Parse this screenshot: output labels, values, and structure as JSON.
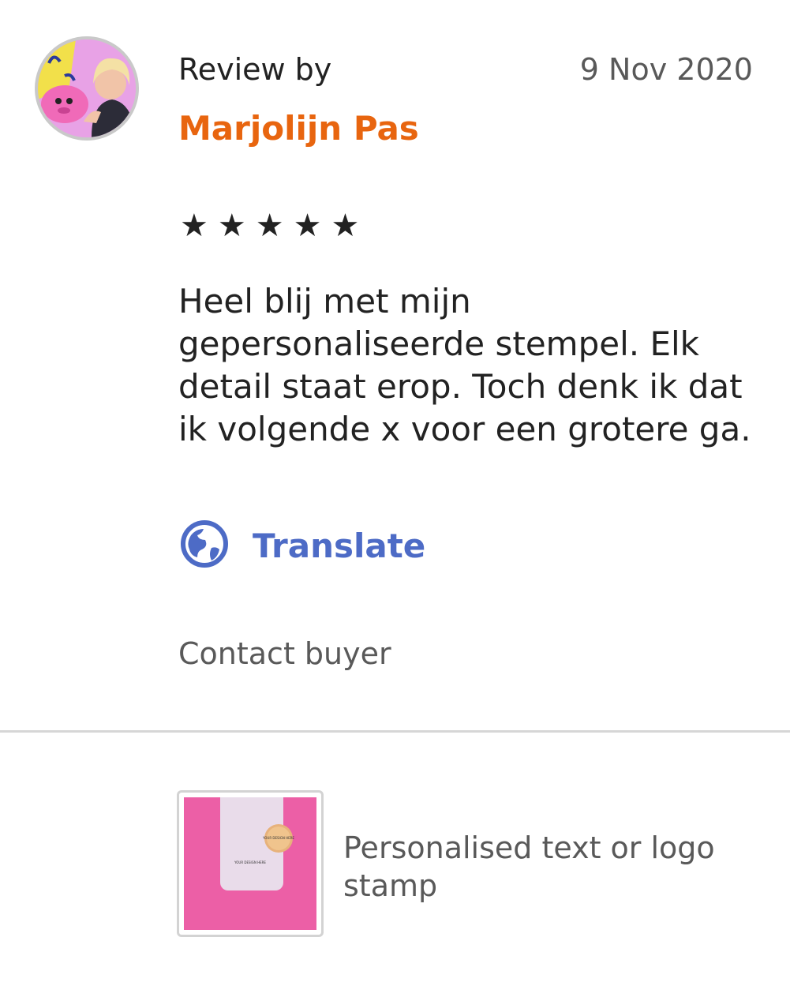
{
  "review": {
    "label": "Review by",
    "date": "9 Nov 2020",
    "reviewer_name": "Marjolijn Pas",
    "rating": 5,
    "stars": [
      "★",
      "★",
      "★",
      "★",
      "★"
    ],
    "text": "Heel blij met mijn gepersonaliseerde stempel. Elk detail staat erop. Toch denk ik dat ik volgende x voor een grotere ga.",
    "translate_label": "Translate",
    "contact_label": "Contact buyer"
  },
  "product": {
    "title": "Personalised text or logo stamp",
    "image_text": "YOUR DESIGN HERE"
  },
  "colors": {
    "reviewer_name": "#e8650f",
    "translate": "#4d6bc6",
    "divider": "#d6d6d6"
  },
  "icons": {
    "translate": "globe-icon",
    "star": "star-icon"
  }
}
